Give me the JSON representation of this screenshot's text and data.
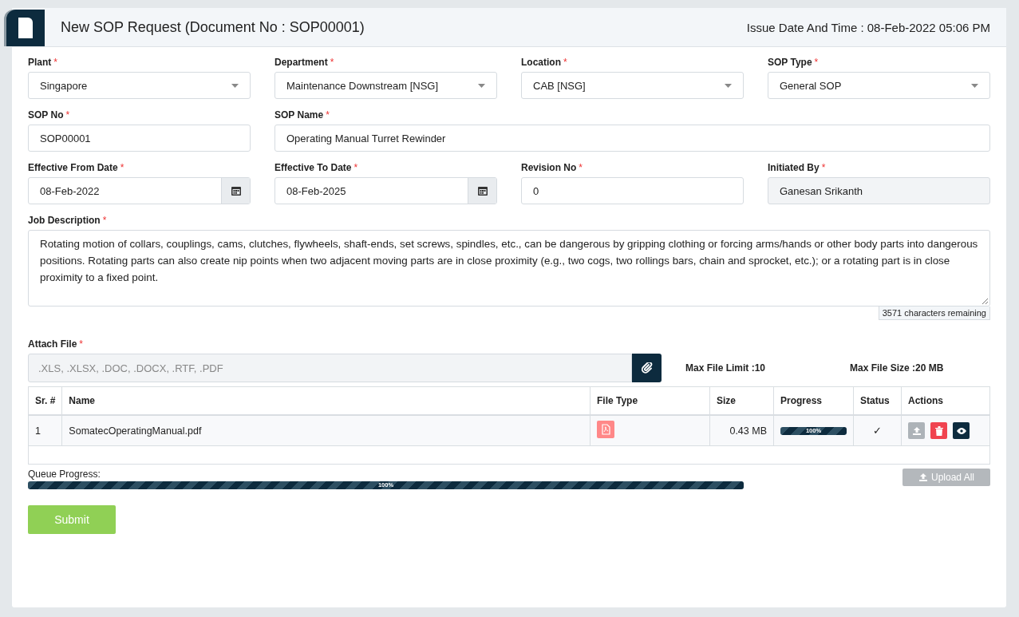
{
  "header": {
    "title": "New SOP Request (Document No : SOP00001)",
    "issue": "Issue Date And Time : 08-Feb-2022 05:06 PM"
  },
  "rows": [
    [
      {
        "label": "Plant",
        "mark": "*",
        "kind": "select",
        "value": "Singapore"
      },
      {
        "label": "Department",
        "mark": "*",
        "kind": "select",
        "value": "Maintenance Downstream [NSG]"
      },
      {
        "label": "Location",
        "mark": "*",
        "kind": "select",
        "value": "CAB [NSG]"
      },
      {
        "label": "SOP Type",
        "mark": "*",
        "kind": "select",
        "value": "General SOP"
      }
    ],
    [
      {
        "label": "SOP No",
        "mark": "*",
        "kind": "input",
        "value": "SOP00001"
      },
      {
        "label": "SOP Name",
        "mark": "*",
        "kind": "input",
        "value": "Operating Manual Turret Rewinder"
      }
    ],
    [
      {
        "label": "Effective From Date",
        "mark": "*",
        "kind": "date",
        "value": "08-Feb-2022"
      },
      {
        "label": "Effective To Date",
        "mark": "*",
        "kind": "date",
        "value": "08-Feb-2025"
      },
      {
        "label": "Revision No",
        "mark": "*",
        "kind": "input",
        "value": "0"
      },
      {
        "label": "Initiated By",
        "mark": "*",
        "kind": "readonly",
        "value": "Ganesan Srikanth"
      }
    ]
  ],
  "job": {
    "label": "Job Description",
    "mark": "*",
    "value": "Rotating motion of collars, couplings, cams, clutches, flywheels, shaft-ends, set screws, spindles, etc., can be dangerous by gripping clothing or forcing arms/hands or other body parts into dangerous positions. Rotating parts can also create nip points when two adjacent moving parts are in close proximity (e.g., two cogs, two rollings bars, chain and sprocket, etc.); or a rotating part is in close proximity to a fixed point.",
    "remaining": "3571 characters remaining"
  },
  "attach": {
    "label": "Attach File",
    "mark": "*",
    "placeholder": ".XLS, .XLSX, .DOC, .DOCX, .RTF, .PDF",
    "limit": "Max File Limit :10",
    "size": "Max File Size :20 MB"
  },
  "table": {
    "columns": [
      "Sr. #",
      "Name",
      "File Type",
      "Size",
      "Progress",
      "Status",
      "Actions"
    ],
    "rows": [
      {
        "sr": "1",
        "name": "SomatecOperatingManual.pdf",
        "size": "0.43 MB",
        "level": 1,
        "progress": "100%",
        "status": "✓",
        "upload_disabled": true
      }
    ]
  },
  "queue": {
    "label": "Queue Progress:",
    "level": 1,
    "text": "100%"
  },
  "upload_all": {
    "label": "Upload All",
    "disabled": true
  },
  "submit": {
    "label": "Submit",
    "disabled": true
  }
}
